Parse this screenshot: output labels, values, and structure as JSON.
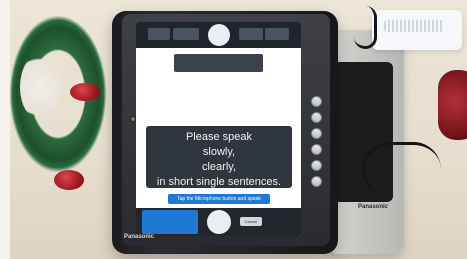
{
  "screen": {
    "instruction_lines": [
      "Please speak",
      "slowly,",
      "clearly,",
      "in short single sentences."
    ],
    "tap_hint": "Tap the Microphone button and speak",
    "cancel_label": "Cancel"
  },
  "device": {
    "brand": "Panasonic",
    "dock_brand": "Panasonic"
  }
}
